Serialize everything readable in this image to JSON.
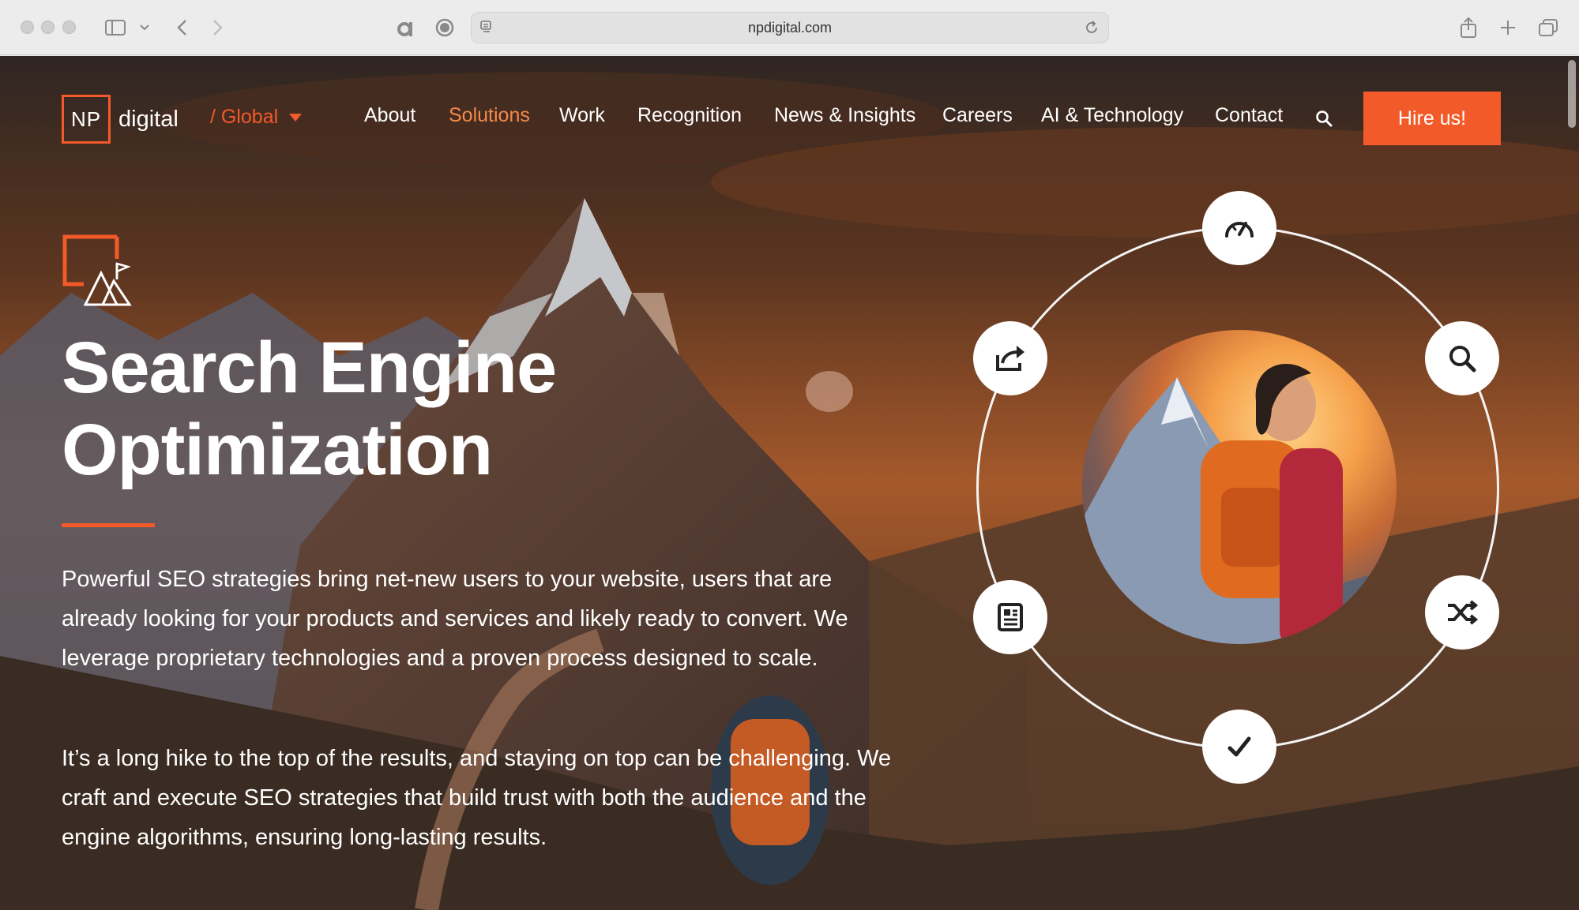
{
  "browser": {
    "url": "npdigital.com"
  },
  "nav": {
    "logo_mark": "NP",
    "logo_word": "digital",
    "region": "/ Global",
    "items": [
      {
        "label": "About",
        "active": false
      },
      {
        "label": "Solutions",
        "active": true
      },
      {
        "label": "Work",
        "active": false
      },
      {
        "label": "Recognition",
        "active": false
      },
      {
        "label": "News & Insights",
        "active": false
      },
      {
        "label": "Careers",
        "active": false
      },
      {
        "label": "AI & Technology",
        "active": false
      },
      {
        "label": "Contact",
        "active": false
      }
    ],
    "cta": "Hire us!"
  },
  "hero": {
    "title_line1": "Search Engine",
    "title_line2": "Optimization",
    "paragraph1": "Powerful SEO strategies bring net-new users to your website, users that are already looking for your products and services and likely ready to convert. We leverage proprietary technologies and a proven process designed to scale.",
    "paragraph2": "It’s a long hike to the top of the results, and staying on top can be challenging. We craft and execute SEO strategies that build trust with both the audience and the engine algorithms, ensuring long-lasting results."
  },
  "graphic": {
    "nodes": [
      "speedometer-icon",
      "search-icon",
      "shuffle-icon",
      "checkmark-icon",
      "document-icon",
      "share-icon"
    ]
  },
  "colors": {
    "accent": "#f25a29",
    "text": "#ffffff"
  }
}
